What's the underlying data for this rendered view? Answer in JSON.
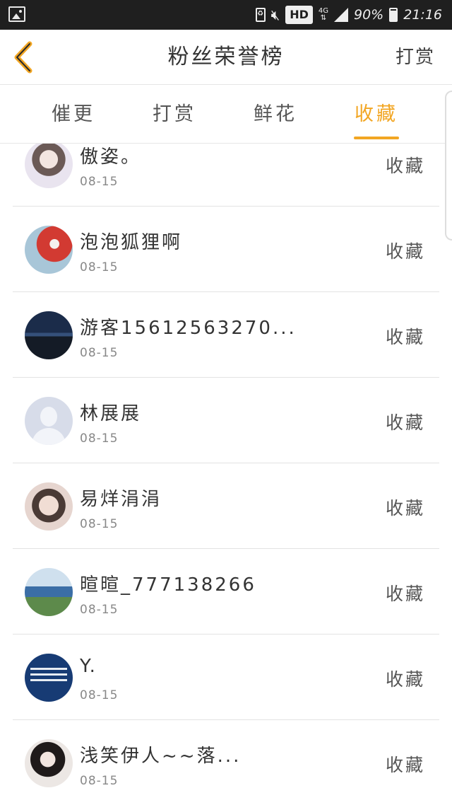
{
  "status_bar": {
    "hd_label": "HD",
    "network_label": "4G",
    "battery": "90%",
    "time": "21:16",
    "icons": [
      "gallery-icon",
      "recycle-icon",
      "mute-icon",
      "signal-icon",
      "battery-icon"
    ]
  },
  "header": {
    "title": "粉丝荣誉榜",
    "action_label": "打赏",
    "back_icon": "chevron-left-icon",
    "accent_color": "#f2a623"
  },
  "tabs": [
    {
      "label": "催更",
      "active": false
    },
    {
      "label": "打赏",
      "active": false
    },
    {
      "label": "鲜花",
      "active": false
    },
    {
      "label": "收藏",
      "active": true
    }
  ],
  "list": [
    {
      "name": "傲姿。",
      "date": "08-15",
      "type": "收藏"
    },
    {
      "name": "泡泡狐狸啊",
      "date": "08-15",
      "type": "收藏"
    },
    {
      "name": "游客15612563270...",
      "date": "08-15",
      "type": "收藏"
    },
    {
      "name": "林展展",
      "date": "08-15",
      "type": "收藏"
    },
    {
      "name": "易烊涓涓",
      "date": "08-15",
      "type": "收藏"
    },
    {
      "name": "暄暄_777138266",
      "date": "08-15",
      "type": "收藏"
    },
    {
      "name": "Y.",
      "date": "08-15",
      "type": "收藏"
    },
    {
      "name": "浅笑伊人~~落...",
      "date": "08-15",
      "type": "收藏"
    }
  ]
}
